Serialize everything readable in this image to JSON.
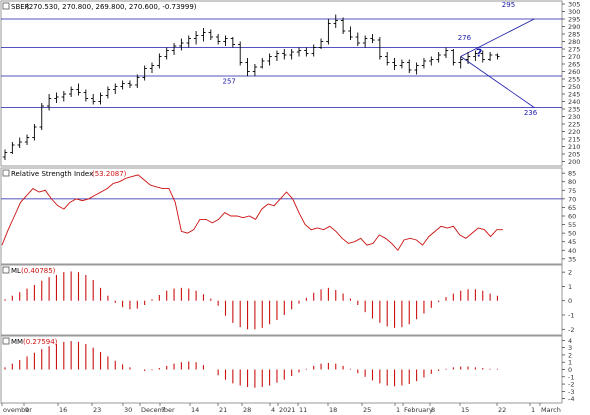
{
  "colors": {
    "background": "#ffffff",
    "frame": "#9a9a9a",
    "level_line": "#1a1aa8",
    "price_bars": "#000000",
    "annotation": "#1a1aa8",
    "rsi_line": "#cc1111",
    "histogram": "#cc1111",
    "rsi_level": "#1a1aa8",
    "legend_value": "#cc1111",
    "axis_text": "#333333"
  },
  "panels": {
    "price": {
      "legend_name": "SBER",
      "legend_value": "(270.530, 270.800, 269.800, 270.600, -0.73999)",
      "ticks": [
        "305",
        "300",
        "295",
        "290",
        "285",
        "280",
        "275",
        "270",
        "265",
        "260",
        "255",
        "250",
        "245",
        "240",
        "235",
        "230",
        "225",
        "220",
        "215",
        "210",
        "205",
        "200"
      ],
      "annotations": [
        "295",
        "276",
        "?",
        "257",
        "236"
      ]
    },
    "rsi": {
      "legend_name": "Relative Strength Index",
      "legend_value": "(53.2087)",
      "ticks": [
        "85",
        "80",
        "75",
        "70",
        "65",
        "60",
        "55",
        "50",
        "45",
        "40",
        "35"
      ]
    },
    "ml": {
      "legend_name": "ML",
      "legend_value": "(0.40785)",
      "ticks": [
        "2",
        "1",
        "0",
        "-1",
        "-2"
      ]
    },
    "mm": {
      "legend_name": "MM",
      "legend_value": "(0.27594)",
      "ticks": [
        "4",
        "3",
        "2",
        "1",
        "0",
        "-1",
        "-2",
        "-3",
        "-4"
      ]
    }
  },
  "time_axis": {
    "labels": [
      "ovember",
      "9",
      "16",
      "23",
      "30",
      "December",
      "7",
      "14",
      "21",
      "28",
      "4",
      "2021",
      "11",
      "18",
      "25",
      "1",
      "February",
      "8",
      "15",
      "22",
      "1",
      "March"
    ]
  },
  "chart_data": [
    {
      "type": "ohlc",
      "symbol": "SBER",
      "x_labels": [
        "ovember",
        "9",
        "16",
        "23",
        "30",
        "December",
        "7",
        "14",
        "21",
        "28",
        "4",
        "2021",
        "11",
        "18",
        "25",
        "1",
        "February",
        "8",
        "15",
        "22",
        "1",
        "March"
      ],
      "ylim": [
        197,
        307
      ],
      "levels": [
        295,
        276,
        257,
        236
      ],
      "trend_lines": [
        {
          "from": [
            62,
            270
          ],
          "to": [
            72,
            295
          ]
        },
        {
          "from": [
            62,
            270
          ],
          "to": [
            72,
            236
          ]
        }
      ],
      "bars": [
        [
          203,
          208,
          201,
          206
        ],
        [
          206,
          213,
          205,
          211
        ],
        [
          211,
          216,
          209,
          213
        ],
        [
          213,
          218,
          211,
          216
        ],
        [
          216,
          225,
          214,
          223
        ],
        [
          223,
          239,
          221,
          237
        ],
        [
          237,
          245,
          234,
          242
        ],
        [
          242,
          246,
          239,
          243
        ],
        [
          243,
          247,
          240,
          245
        ],
        [
          245,
          250,
          243,
          248
        ],
        [
          248,
          252,
          244,
          246
        ],
        [
          246,
          248,
          240,
          242
        ],
        [
          242,
          245,
          238,
          240
        ],
        [
          240,
          246,
          238,
          244
        ],
        [
          244,
          250,
          242,
          248
        ],
        [
          248,
          252,
          245,
          250
        ],
        [
          250,
          254,
          248,
          252
        ],
        [
          252,
          254,
          249,
          251
        ],
        [
          251,
          258,
          249,
          256
        ],
        [
          256,
          264,
          254,
          262
        ],
        [
          262,
          266,
          259,
          264
        ],
        [
          264,
          272,
          262,
          270
        ],
        [
          270,
          276,
          268,
          274
        ],
        [
          274,
          279,
          271,
          277
        ],
        [
          277,
          282,
          274,
          279
        ],
        [
          279,
          284,
          276,
          282
        ],
        [
          282,
          287,
          278,
          284
        ],
        [
          284,
          289,
          280,
          286
        ],
        [
          286,
          288,
          281,
          283
        ],
        [
          283,
          285,
          278,
          280
        ],
        [
          280,
          284,
          277,
          282
        ],
        [
          282,
          283,
          276,
          278
        ],
        [
          278,
          280,
          264,
          266
        ],
        [
          266,
          269,
          257,
          260
        ],
        [
          260,
          265,
          257,
          263
        ],
        [
          263,
          269,
          262,
          267
        ],
        [
          267,
          272,
          264,
          270
        ],
        [
          270,
          274,
          267,
          272
        ],
        [
          272,
          275,
          268,
          271
        ],
        [
          271,
          275,
          268,
          273
        ],
        [
          273,
          276,
          270,
          274
        ],
        [
          274,
          276,
          270,
          272
        ],
        [
          272,
          278,
          270,
          276
        ],
        [
          276,
          282,
          275,
          280
        ],
        [
          280,
          295,
          278,
          292
        ],
        [
          292,
          298,
          289,
          294
        ],
        [
          294,
          296,
          285,
          287
        ],
        [
          287,
          290,
          281,
          283
        ],
        [
          283,
          286,
          277,
          279
        ],
        [
          279,
          284,
          276,
          282
        ],
        [
          282,
          285,
          279,
          281
        ],
        [
          281,
          283,
          268,
          270
        ],
        [
          270,
          273,
          264,
          266
        ],
        [
          266,
          269,
          261,
          264
        ],
        [
          264,
          268,
          262,
          266
        ],
        [
          266,
          268,
          259,
          261
        ],
        [
          261,
          266,
          258,
          264
        ],
        [
          264,
          269,
          262,
          267
        ],
        [
          267,
          270,
          264,
          268
        ],
        [
          268,
          273,
          266,
          271
        ],
        [
          271,
          276,
          269,
          274
        ],
        [
          274,
          275,
          264,
          266
        ],
        [
          266,
          270,
          262,
          268
        ],
        [
          268,
          273,
          265,
          270
        ],
        [
          270,
          274,
          267,
          272
        ],
        [
          272,
          274,
          266,
          268
        ],
        [
          268,
          273,
          267,
          271
        ],
        [
          271,
          272,
          268,
          270
        ]
      ],
      "labels": [
        {
          "text": "295",
          "x": 68.5,
          "y": 303
        },
        {
          "text": "276",
          "x": 62.5,
          "y": 281
        },
        {
          "text": "?",
          "x": 64.5,
          "y": 270
        },
        {
          "text": "257",
          "x": 30.5,
          "y": 252
        },
        {
          "text": "236",
          "x": 71.5,
          "y": 231
        }
      ]
    },
    {
      "type": "line",
      "name": "Relative Strength Index",
      "ylim": [
        32,
        88
      ],
      "levels": [
        70
      ],
      "values": [
        43,
        52,
        60,
        68,
        72,
        76,
        74,
        75,
        70,
        66,
        64,
        68,
        70,
        69,
        70,
        72,
        74,
        76,
        79,
        80,
        82,
        83,
        84,
        81,
        78,
        77,
        76,
        76,
        68,
        51,
        50,
        52,
        58,
        58,
        56,
        58,
        62,
        60,
        60,
        59,
        60,
        58,
        64,
        67,
        66,
        70,
        74,
        70,
        62,
        55,
        52,
        53,
        52,
        54,
        51,
        47,
        44,
        45,
        47,
        43,
        44,
        49,
        47,
        44,
        40,
        46,
        47,
        46,
        43,
        48,
        51,
        54,
        53,
        54,
        49,
        47,
        50,
        53,
        52,
        48,
        52,
        52
      ]
    },
    {
      "type": "histogram",
      "name": "ML",
      "ylim": [
        -2.4,
        2.5
      ],
      "values": [
        0.1,
        0.35,
        0.6,
        0.85,
        1.1,
        1.4,
        1.65,
        1.8,
        2.0,
        2.05,
        2.0,
        1.8,
        1.45,
        0.9,
        0.35,
        -0.15,
        -0.45,
        -0.6,
        -0.55,
        -0.3,
        0.1,
        0.4,
        0.7,
        0.85,
        0.9,
        0.85,
        0.7,
        0.45,
        0.15,
        -0.35,
        -1.05,
        -1.55,
        -1.85,
        -2.0,
        -2.0,
        -1.9,
        -1.65,
        -1.35,
        -1.0,
        -0.6,
        -0.2,
        0.2,
        0.55,
        0.8,
        0.9,
        0.75,
        0.5,
        0.15,
        -0.3,
        -0.8,
        -1.25,
        -1.55,
        -1.8,
        -1.9,
        -1.85,
        -1.65,
        -1.3,
        -0.9,
        -0.5,
        -0.1,
        0.25,
        0.5,
        0.7,
        0.8,
        0.8,
        0.7,
        0.5,
        0.35
      ]
    },
    {
      "type": "histogram",
      "name": "MM",
      "ylim": [
        -4.6,
        4.6
      ],
      "values": [
        0.3,
        0.8,
        1.3,
        1.8,
        2.3,
        2.8,
        3.2,
        3.5,
        3.8,
        3.9,
        3.8,
        3.5,
        3.0,
        2.4,
        1.8,
        1.2,
        0.7,
        0.3,
        0.0,
        -0.2,
        -0.1,
        0.2,
        0.5,
        0.8,
        1.0,
        1.1,
        1.0,
        0.6,
        0.0,
        -0.8,
        -1.4,
        -1.9,
        -2.2,
        -2.4,
        -2.5,
        -2.4,
        -2.2,
        -1.8,
        -1.4,
        -0.9,
        -0.4,
        0.1,
        0.5,
        0.8,
        0.9,
        0.8,
        0.5,
        0.1,
        -0.5,
        -1.0,
        -1.5,
        -1.9,
        -2.2,
        -2.3,
        -2.2,
        -2.0,
        -1.6,
        -1.1,
        -0.6,
        -0.2,
        0.1,
        0.3,
        0.4,
        0.4,
        0.3,
        0.2,
        0.1,
        0.1
      ]
    }
  ]
}
